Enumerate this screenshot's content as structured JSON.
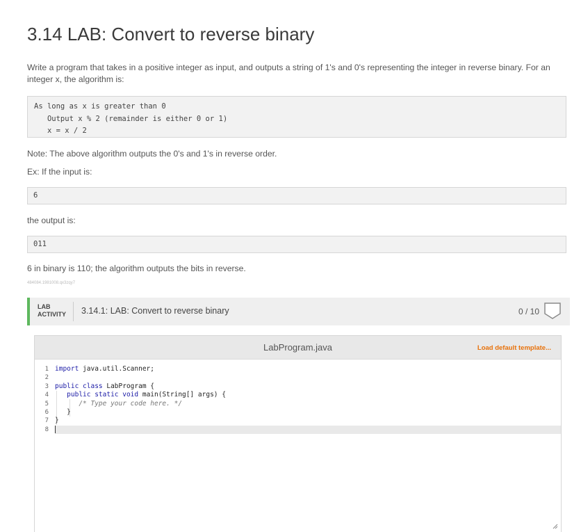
{
  "title": "3.14 LAB: Convert to reverse binary",
  "intro": "Write a program that takes in a positive integer as input, and outputs a string of 1's and 0's representing the integer in reverse binary. For an integer x, the algorithm is:",
  "algorithm": {
    "line1": "As long as x is greater than 0",
    "line2": "   Output x % 2 (remainder is either 0 or 1)",
    "line3": "   x = x / 2"
  },
  "note": "Note: The above algorithm outputs the 0's and 1's in reverse order.",
  "example_label": "Ex: If the input is:",
  "example_input": "6",
  "output_label": "the output is:",
  "example_output": "011",
  "explanation": "6 in binary is 110; the algorithm outputs the bits in reverse.",
  "tiny_id": "484084.1981008.qx3zqy7",
  "lab": {
    "tag_line1": "LAB",
    "tag_line2": "ACTIVITY",
    "title": "3.14.1: LAB: Convert to reverse binary",
    "score": "0 / 10"
  },
  "editor": {
    "file_name": "LabProgram.java",
    "load_template_label": "Load default template...",
    "line_numbers": [
      "1",
      "2",
      "3",
      "4",
      "5",
      "6",
      "7",
      "8"
    ],
    "code": {
      "l1_kw": "import",
      "l1_rest": " java.util.Scanner;",
      "l3_kw": "public class",
      "l3_rest": " LabProgram {",
      "l4_kw": "public static void",
      "l4_rest": " main(String[] args) {",
      "l5_comment": "/* Type your code here. */",
      "l6": "}",
      "l7": "}"
    }
  },
  "colors": {
    "accent_green": "#5eb85e",
    "link_orange": "#e8710a"
  }
}
